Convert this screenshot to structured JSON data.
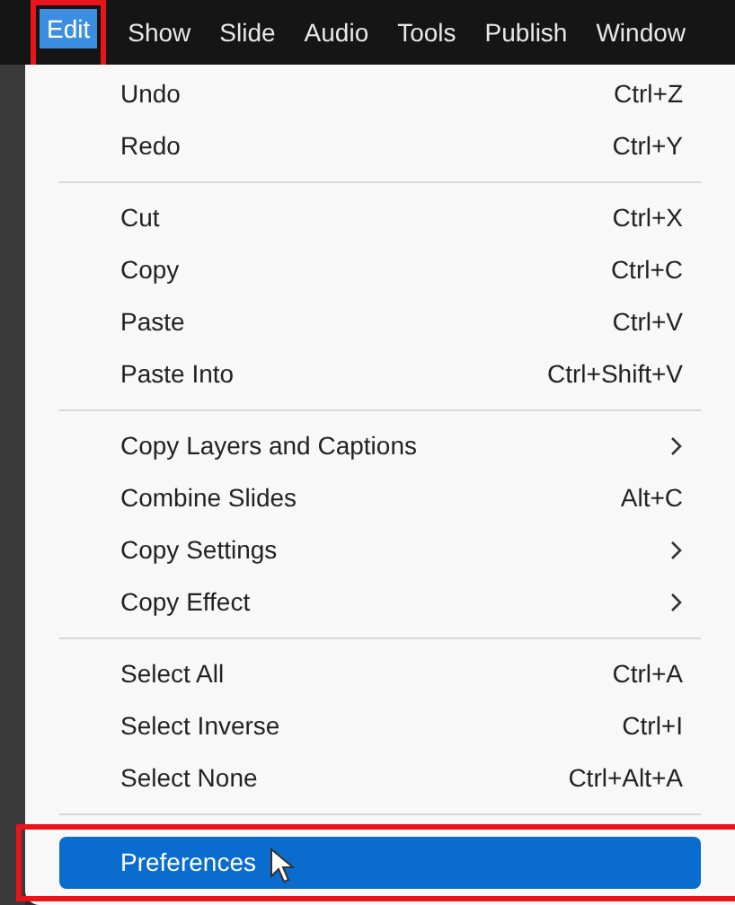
{
  "menubar": [
    {
      "label": "Edit",
      "selected": true,
      "annotated": true
    },
    {
      "label": "Show",
      "selected": false,
      "annotated": false
    },
    {
      "label": "Slide",
      "selected": false,
      "annotated": false
    },
    {
      "label": "Audio",
      "selected": false,
      "annotated": false
    },
    {
      "label": "Tools",
      "selected": false,
      "annotated": false
    },
    {
      "label": "Publish",
      "selected": false,
      "annotated": false
    },
    {
      "label": "Window",
      "selected": false,
      "annotated": false
    }
  ],
  "menu": {
    "groups": [
      {
        "items": [
          {
            "label": "Undo",
            "shortcut": "Ctrl+Z",
            "submenu": false,
            "selected": false,
            "annotated": false
          },
          {
            "label": "Redo",
            "shortcut": "Ctrl+Y",
            "submenu": false,
            "selected": false,
            "annotated": false
          }
        ]
      },
      {
        "items": [
          {
            "label": "Cut",
            "shortcut": "Ctrl+X",
            "submenu": false,
            "selected": false,
            "annotated": false
          },
          {
            "label": "Copy",
            "shortcut": "Ctrl+C",
            "submenu": false,
            "selected": false,
            "annotated": false
          },
          {
            "label": "Paste",
            "shortcut": "Ctrl+V",
            "submenu": false,
            "selected": false,
            "annotated": false
          },
          {
            "label": "Paste Into",
            "shortcut": "Ctrl+Shift+V",
            "submenu": false,
            "selected": false,
            "annotated": false
          }
        ]
      },
      {
        "items": [
          {
            "label": "Copy Layers and Captions",
            "submenu": true,
            "selected": false,
            "annotated": false
          },
          {
            "label": "Combine Slides",
            "shortcut": "Alt+C",
            "submenu": false,
            "selected": false,
            "annotated": false
          },
          {
            "label": "Copy Settings",
            "submenu": true,
            "selected": false,
            "annotated": false
          },
          {
            "label": "Copy Effect",
            "submenu": true,
            "selected": false,
            "annotated": false
          }
        ]
      },
      {
        "items": [
          {
            "label": "Select All",
            "shortcut": "Ctrl+A",
            "submenu": false,
            "selected": false,
            "annotated": false
          },
          {
            "label": "Select Inverse",
            "shortcut": "Ctrl+I",
            "submenu": false,
            "selected": false,
            "annotated": false
          },
          {
            "label": "Select None",
            "shortcut": "Ctrl+Alt+A",
            "submenu": false,
            "selected": false,
            "annotated": false
          }
        ]
      },
      {
        "items": [
          {
            "label": "Preferences",
            "submenu": false,
            "selected": true,
            "annotated": true
          }
        ]
      }
    ]
  }
}
